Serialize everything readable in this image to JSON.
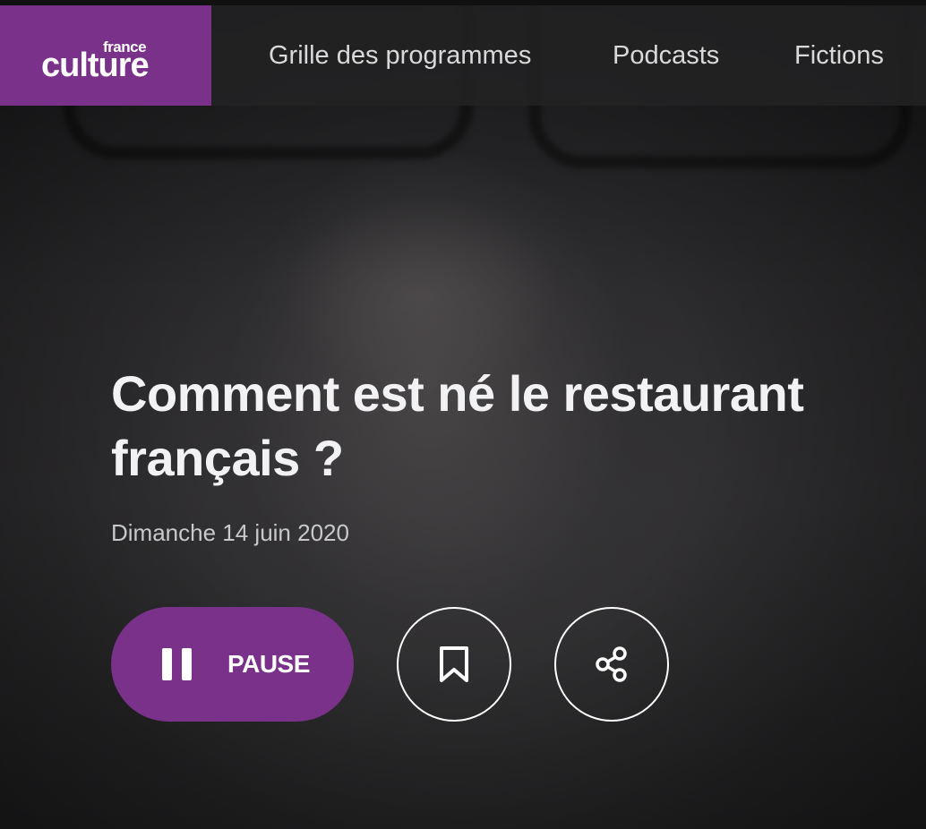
{
  "brand": {
    "logo_small": "france",
    "logo_big": "culture",
    "accent_color": "#7a3189"
  },
  "nav": {
    "items": [
      {
        "label": "Grille des programmes"
      },
      {
        "label": "Podcasts"
      },
      {
        "label": "Fictions"
      }
    ]
  },
  "episode": {
    "title": "Comment est né le restaurant français ?",
    "date": "Dimanche 14 juin 2020"
  },
  "player": {
    "pause_label": "PAUSE",
    "pause_icon": "pause-icon",
    "bookmark_icon": "bookmark-icon",
    "share_icon": "share-icon"
  }
}
